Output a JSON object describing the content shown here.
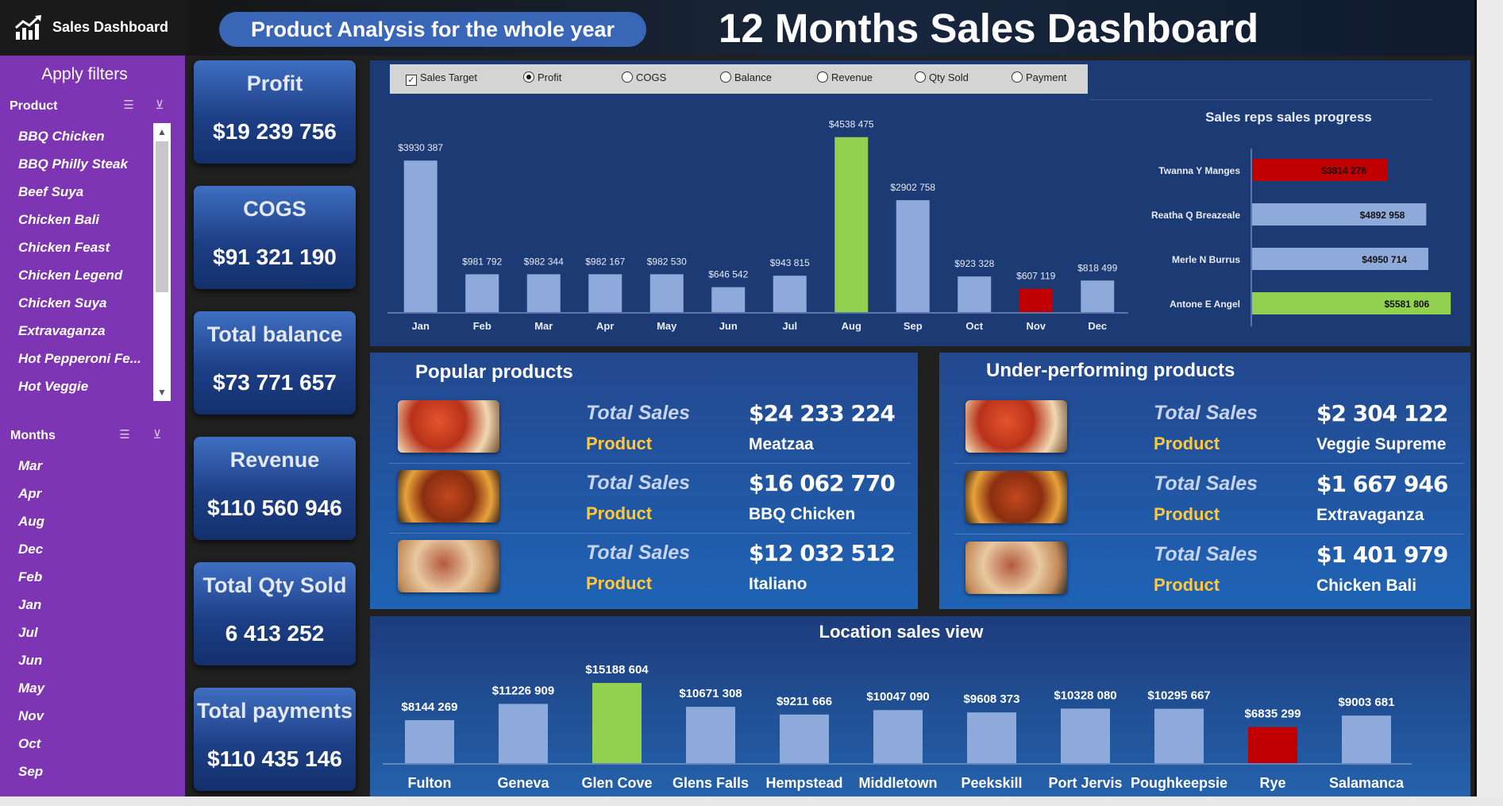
{
  "app": {
    "title": "Sales Dashboard",
    "banner": "Product Analysis for the whole year",
    "main_title": "12 Months Sales Dashboard"
  },
  "sidebar": {
    "filters_title": "Apply filters",
    "product_slicer": {
      "title": "Product",
      "items": [
        "BBQ Chicken",
        "BBQ Philly Steak",
        "Beef Suya",
        "Chicken Bali",
        "Chicken Feast",
        "Chicken Legend",
        "Chicken Suya",
        "Extravaganza",
        "Hot Pepperoni Fe...",
        "Hot Veggie"
      ]
    },
    "months_slicer": {
      "title": "Months",
      "items": [
        "Mar",
        "Apr",
        "Aug",
        "Dec",
        "Feb",
        "Jan",
        "Jul",
        "Jun",
        "May",
        "Nov",
        "Oct",
        "Sep"
      ]
    }
  },
  "kpis": [
    {
      "label": "Profit",
      "value": "$19 239 756"
    },
    {
      "label": "COGS",
      "value": "$91 321 190"
    },
    {
      "label": "Total balance",
      "value": "$73 771 657"
    },
    {
      "label": "Revenue",
      "value": "$110 560 946"
    },
    {
      "label": "Total Qty Sold",
      "value": "6 413 252"
    },
    {
      "label": "Total payments",
      "value": "$110 435 146"
    }
  ],
  "series_options": {
    "checkbox": "Sales Target",
    "radios": [
      "Profit",
      "COGS",
      "Balance",
      "Revenue",
      "Qty Sold",
      "Payment"
    ],
    "selected": "Profit"
  },
  "colors": {
    "bar": "#8eaadb",
    "highlight_max": "#92d050",
    "highlight_min": "#c00000",
    "accent_gold": "#ffc83d"
  },
  "chart_data": [
    {
      "type": "bar",
      "categories": [
        "Jan",
        "Feb",
        "Mar",
        "Apr",
        "May",
        "Jun",
        "Jul",
        "Aug",
        "Sep",
        "Oct",
        "Nov",
        "Dec"
      ],
      "values": [
        3930387,
        981792,
        982344,
        982167,
        982530,
        646542,
        943815,
        4538475,
        2902758,
        923328,
        607119,
        818499
      ],
      "labels": [
        "$3930 387",
        "$981 792",
        "$982 344",
        "$982 167",
        "$982 530",
        "$646 542",
        "$943 815",
        "$4538 475",
        "$2902 758",
        "$923 328",
        "$607 119",
        "$818 499"
      ],
      "highlight": {
        "max_index": 7,
        "min_index": 10
      },
      "ylim": [
        0,
        4800000
      ]
    },
    {
      "type": "bar",
      "orientation": "horizontal",
      "title": "Sales reps sales progress",
      "categories": [
        "Twanna Y Manges",
        "Reatha Q Breazeale",
        "Merle N Burrus",
        "Antone E Angel"
      ],
      "values": [
        3814278,
        4892958,
        4950714,
        5581806
      ],
      "labels": [
        "$3814 278",
        "$4892 958",
        "$4950 714",
        "$5581 806"
      ],
      "bar_colors": [
        "#c00000",
        "#8eaadb",
        "#8eaadb",
        "#92d050"
      ],
      "xlim": [
        0,
        5800000
      ]
    },
    {
      "type": "bar",
      "title": "Location sales view",
      "categories": [
        "Fulton",
        "Geneva",
        "Glen Cove",
        "Glens Falls",
        "Hempstead",
        "Middletown",
        "Peekskill",
        "Port Jervis",
        "Poughkeepsie",
        "Rye",
        "Salamanca"
      ],
      "values": [
        8144269,
        11226909,
        15188604,
        10671308,
        9211666,
        10047090,
        9608373,
        10328080,
        10295667,
        6835299,
        9003681
      ],
      "labels": [
        "$8144 269",
        "$11226 909",
        "$15188 604",
        "$10671 308",
        "$9211 666",
        "$10047 090",
        "$9608 373",
        "$10328 080",
        "$10295 667",
        "$6835 299",
        "$9003 681"
      ],
      "highlight": {
        "max_index": 2,
        "min_index": 9
      },
      "ylim": [
        0,
        15500000
      ]
    }
  ],
  "popular": {
    "title": "Popular products",
    "items": [
      {
        "sales_label": "Total Sales",
        "sales": "$24 233 224",
        "product_label": "Product",
        "product": "Meatzaa",
        "icon": "pizza-slices-photo"
      },
      {
        "sales_label": "Total Sales",
        "sales": "$16 062 770",
        "product_label": "Product",
        "product": "BBQ Chicken",
        "icon": "bbq-chicken-photo"
      },
      {
        "sales_label": "Total Sales",
        "sales": "$12 032 512",
        "product_label": "Product",
        "product": "Italiano",
        "icon": "pizza-photo"
      }
    ]
  },
  "under": {
    "title": "Under-performing products",
    "items": [
      {
        "sales_label": "Total Sales",
        "sales": "$2 304 122",
        "product_label": "Product",
        "product": "Veggie Supreme",
        "icon": "veggie-pizza-photo"
      },
      {
        "sales_label": "Total Sales",
        "sales": "$1 667 946",
        "product_label": "Product",
        "product": "Extravaganza",
        "icon": "extravaganza-pizza-photo"
      },
      {
        "sales_label": "Total Sales",
        "sales": "$1 401 979",
        "product_label": "Product",
        "product": "Chicken Bali",
        "icon": "chicken-skewers-photo"
      }
    ]
  }
}
